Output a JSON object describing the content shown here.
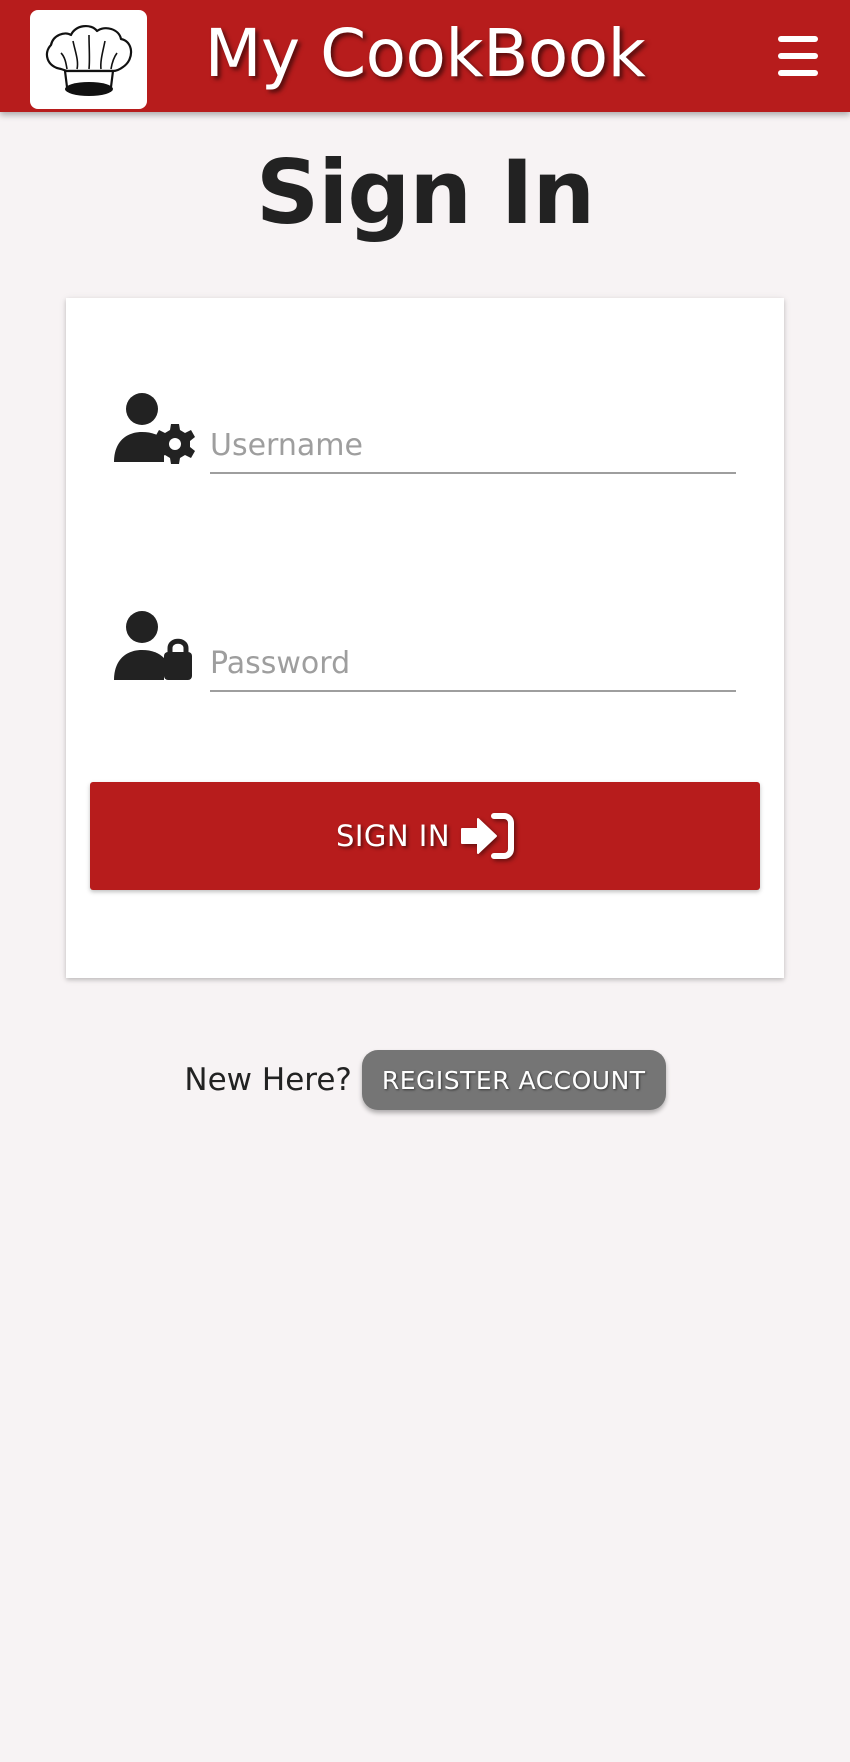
{
  "header": {
    "brand": "My CookBook",
    "logo_icon": "chef-hat-icon",
    "menu_icon": "hamburger-menu-icon",
    "color": "#b71c1c"
  },
  "page": {
    "title": "Sign In"
  },
  "form": {
    "username": {
      "placeholder": "Username",
      "value": "",
      "icon": "user-gear-icon"
    },
    "password": {
      "placeholder": "Password",
      "value": "",
      "icon": "user-lock-icon"
    },
    "submit": {
      "label": "SIGN IN",
      "icon": "sign-in-arrow-icon",
      "color": "#b71c1c"
    }
  },
  "register": {
    "prompt": "New Here?",
    "button_label": "REGISTER ACCOUNT",
    "button_color": "#757575"
  }
}
